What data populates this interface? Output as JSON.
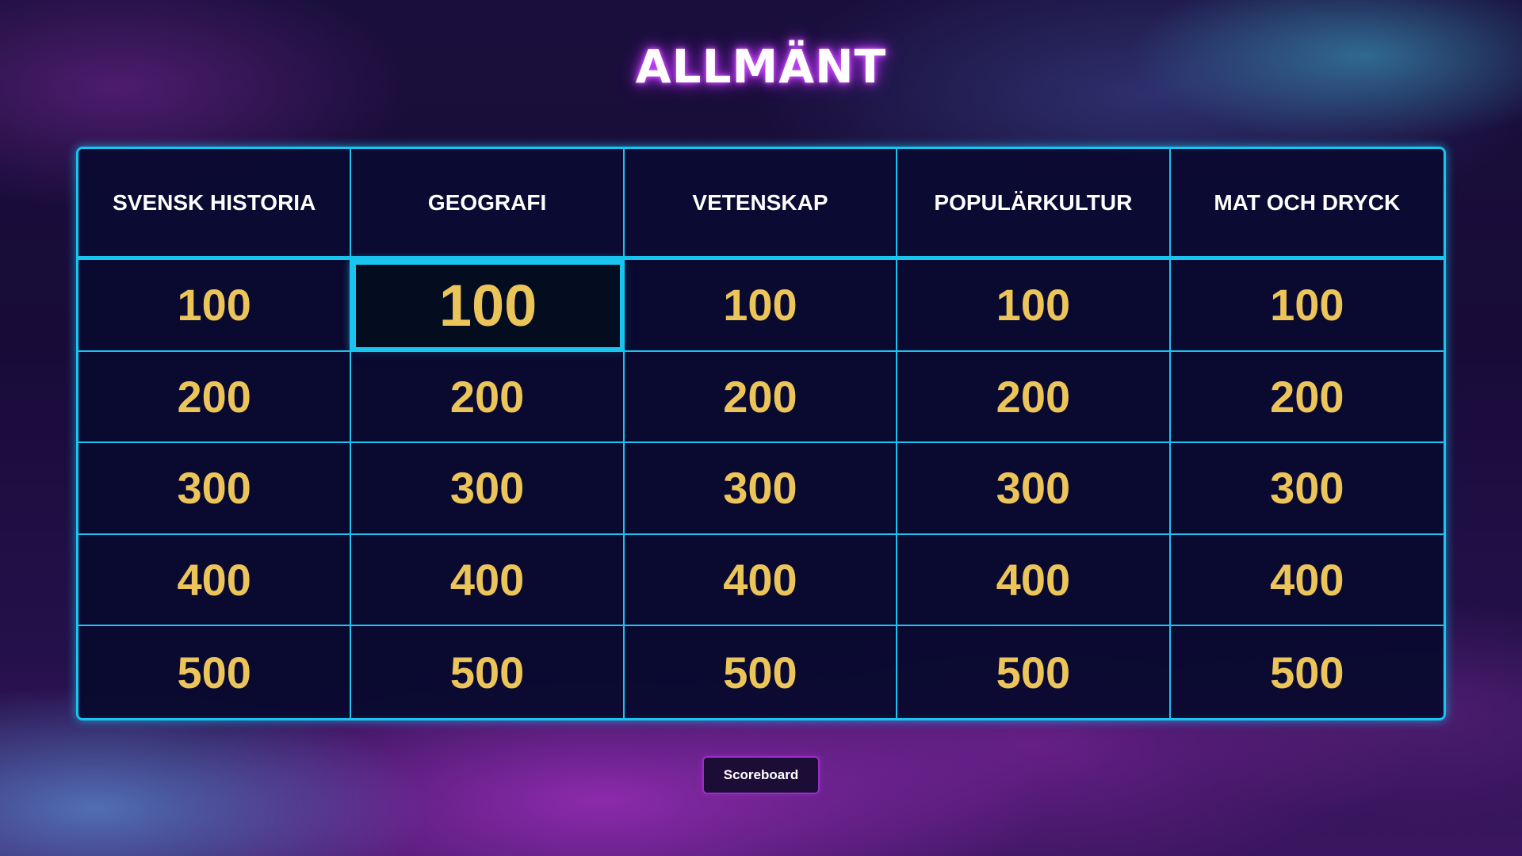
{
  "title": "ALLMÄNT",
  "categories": [
    "SVENSK HISTORIA",
    "GEOGRAFI",
    "VETENSKAP",
    "POPULÄRKULTUR",
    "MAT OCH DRYCK"
  ],
  "rows": [
    [
      "100",
      "100",
      "100",
      "100",
      "100"
    ],
    [
      "200",
      "200",
      "200",
      "200",
      "200"
    ],
    [
      "300",
      "300",
      "300",
      "300",
      "300"
    ],
    [
      "400",
      "400",
      "400",
      "400",
      "400"
    ],
    [
      "500",
      "500",
      "500",
      "500",
      "500"
    ]
  ],
  "selected": {
    "row": 0,
    "col": 1
  },
  "scoreboard_label": "Scoreboard",
  "colors": {
    "accent": "#19c4ef",
    "value": "#ecc55a",
    "title_glow": "#c040ff",
    "button_border": "#9a2fc4"
  }
}
